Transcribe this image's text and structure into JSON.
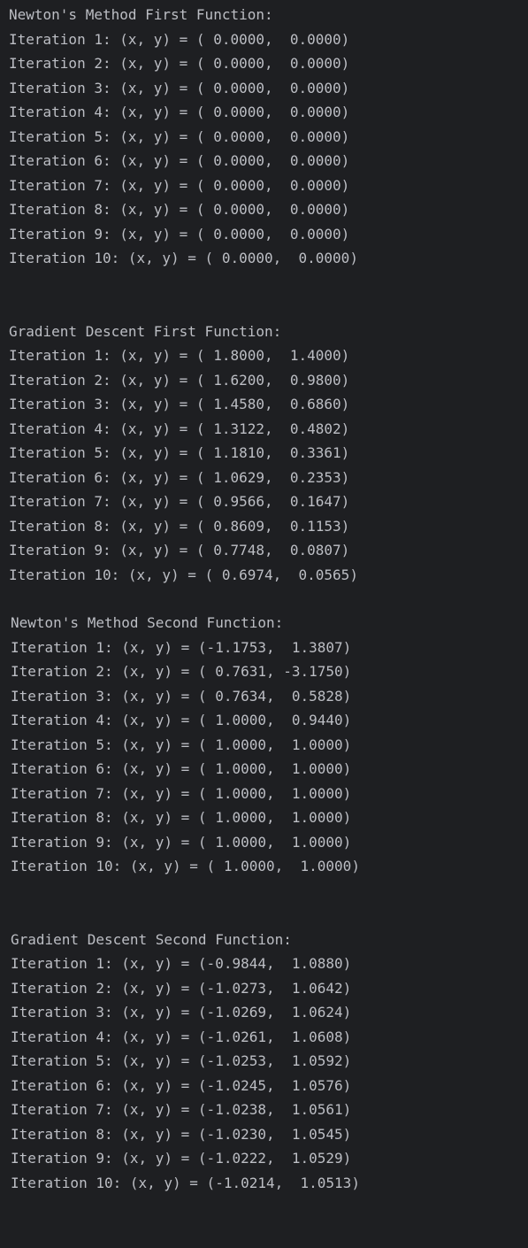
{
  "console": {
    "lines": [
      "Newton's Method First Function:",
      "Iteration 1: (x, y) = ( 0.0000,  0.0000)",
      "Iteration 2: (x, y) = ( 0.0000,  0.0000)",
      "Iteration 3: (x, y) = ( 0.0000,  0.0000)",
      "Iteration 4: (x, y) = ( 0.0000,  0.0000)",
      "Iteration 5: (x, y) = ( 0.0000,  0.0000)",
      "Iteration 6: (x, y) = ( 0.0000,  0.0000)",
      "Iteration 7: (x, y) = ( 0.0000,  0.0000)",
      "Iteration 8: (x, y) = ( 0.0000,  0.0000)",
      "Iteration 9: (x, y) = ( 0.0000,  0.0000)",
      "Iteration 10: (x, y) = ( 0.0000,  0.0000)",
      "Gradient Descent First Function:",
      "Iteration 1: (x, y) = ( 1.8000,  1.4000)",
      "Iteration 2: (x, y) = ( 1.6200,  0.9800)",
      "Iteration 3: (x, y) = ( 1.4580,  0.6860)",
      "Iteration 4: (x, y) = ( 1.3122,  0.4802)",
      "Iteration 5: (x, y) = ( 1.1810,  0.3361)",
      "Iteration 6: (x, y) = ( 1.0629,  0.2353)",
      "Iteration 7: (x, y) = ( 0.9566,  0.1647)",
      "Iteration 8: (x, y) = ( 0.8609,  0.1153)",
      "Iteration 9: (x, y) = ( 0.7748,  0.0807)",
      "Iteration 10: (x, y) = ( 0.6974,  0.0565)",
      "Newton's Method Second Function:",
      "Iteration 1: (x, y) = (-1.1753,  1.3807)",
      "Iteration 2: (x, y) = ( 0.7631, -3.1750)",
      "Iteration 3: (x, y) = ( 0.7634,  0.5828)",
      "Iteration 4: (x, y) = ( 1.0000,  0.9440)",
      "Iteration 5: (x, y) = ( 1.0000,  1.0000)",
      "Iteration 6: (x, y) = ( 1.0000,  1.0000)",
      "Iteration 7: (x, y) = ( 1.0000,  1.0000)",
      "Iteration 8: (x, y) = ( 1.0000,  1.0000)",
      "Iteration 9: (x, y) = ( 1.0000,  1.0000)",
      "Iteration 10: (x, y) = ( 1.0000,  1.0000)",
      "Gradient Descent Second Function:",
      "Iteration 1: (x, y) = (-0.9844,  1.0880)",
      "Iteration 2: (x, y) = (-1.0273,  1.0642)",
      "Iteration 3: (x, y) = (-1.0269,  1.0624)",
      "Iteration 4: (x, y) = (-1.0261,  1.0608)",
      "Iteration 5: (x, y) = (-1.0253,  1.0592)",
      "Iteration 6: (x, y) = (-1.0245,  1.0576)",
      "Iteration 7: (x, y) = (-1.0238,  1.0561)",
      "Iteration 8: (x, y) = (-1.0230,  1.0545)",
      "Iteration 9: (x, y) = (-1.0222,  1.0529)",
      "Iteration 10: (x, y) = (-1.0214,  1.0513)"
    ]
  }
}
